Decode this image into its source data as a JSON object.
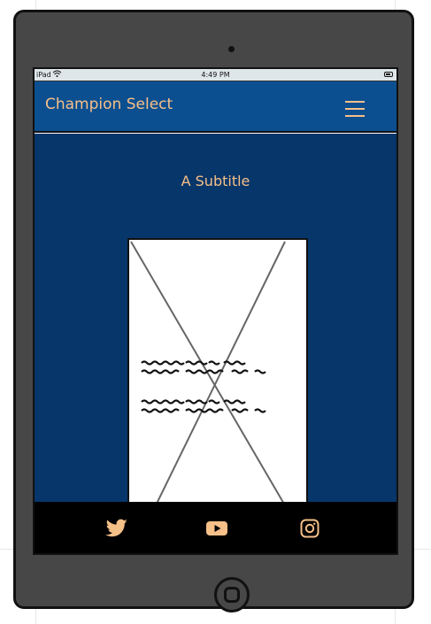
{
  "status_bar": {
    "carrier": "iPad",
    "time": "4:49 PM"
  },
  "navbar": {
    "brand": "Champion Select",
    "menu_icon": "hamburger-icon"
  },
  "main": {
    "subtitle": "A Subtitle",
    "image": "image-placeholder"
  },
  "footer": {
    "social_icons": [
      "twitter-icon",
      "youtube-icon",
      "instagram-icon"
    ]
  },
  "colors": {
    "navbar": "#0c4f91",
    "main_background": "#07366a",
    "accent": "#f6c089",
    "footer": "#000000",
    "device_frame": "#474747"
  }
}
